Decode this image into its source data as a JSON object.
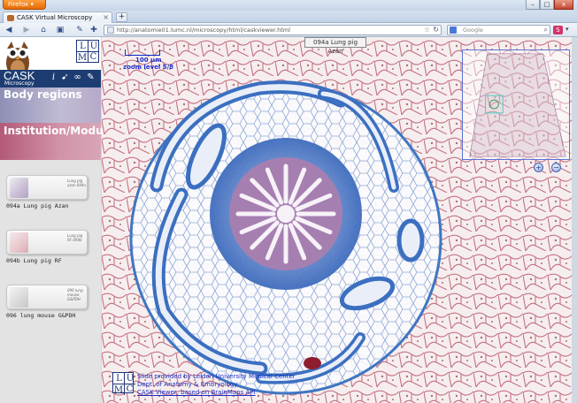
{
  "browser": {
    "app_button": "Firefox",
    "tab_title": "CASK Virtual Microscopy",
    "url": "http://anatomie01.lumc.nl/microscopy/html/caskviewer.html",
    "search_placeholder": "Google",
    "new_tab": "+",
    "tab_close": "×",
    "window_buttons": [
      "–",
      "□",
      "x"
    ]
  },
  "sidebar": {
    "logo_letters": [
      "L",
      "U",
      "M",
      "C"
    ],
    "app_name": "CASK",
    "app_subtitle": "Microscopy",
    "sections": [
      {
        "label": "Body regions"
      },
      {
        "label": "Institution/Module"
      }
    ],
    "slides": [
      {
        "caption": "094a Lung pig Azan",
        "label": "Lung pig azan 094a",
        "specimen_color": "#c9bcd5"
      },
      {
        "caption": "094b Lung pig RF",
        "label": "Lung pig RF 094b",
        "specimen_color": "#e8c7cc"
      },
      {
        "caption": "096 lung mouse G&PDH",
        "label": "096 lung mouse G&PDH",
        "specimen_color": "#d9d9d9"
      }
    ]
  },
  "viewer": {
    "slide_title": "094a Lung pig Azan",
    "scale_label": "100 µm",
    "zoom_label": "zoom level 5/8",
    "zoom_in": "+",
    "zoom_out": "−",
    "credits": [
      "Slide provided by Leiden University Medical Center",
      "Dept. of Anatomy & Embryology",
      "CASK Viewer, based on BrainMaps API"
    ]
  },
  "colors": {
    "accent_navy": "#1d3d72",
    "scale_blue": "#1f2fd0",
    "stain_blue": "#3f76c2",
    "stain_red": "#a01e3a"
  }
}
